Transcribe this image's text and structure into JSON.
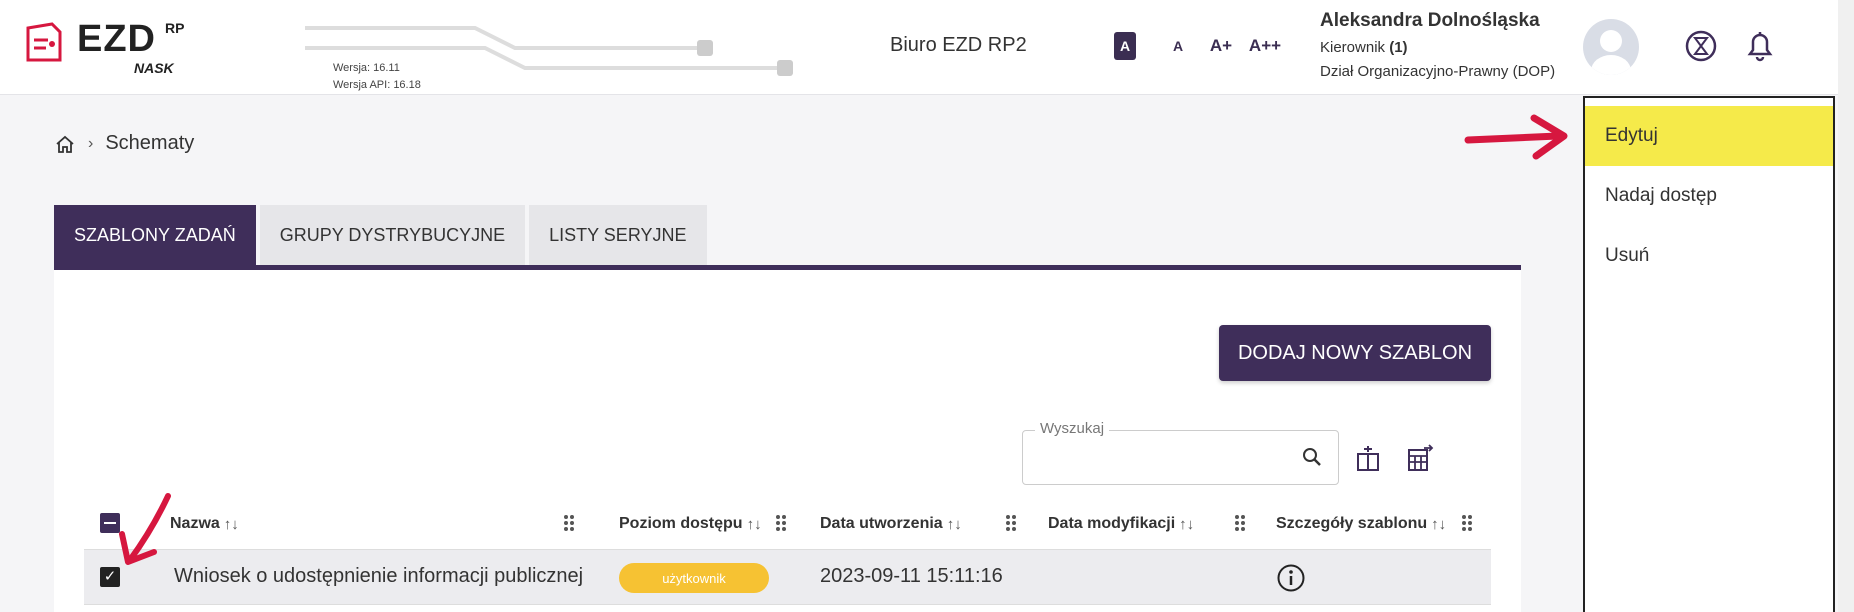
{
  "header": {
    "logo_text": "EZD",
    "logo_superscript": "RP",
    "logo_sub": "NASK",
    "version": "Wersja: 16.11",
    "version_api": "Wersja API: 16.18",
    "office": "Biuro EZD RP2",
    "font_sizes": [
      "A",
      "A",
      "A+",
      "A++"
    ],
    "user_name": "Aleksandra Dolnośląska",
    "user_role": "Kierownik",
    "user_role_count": "(1)",
    "user_department": "Dział Organizacyjno-Prawny (DOP)"
  },
  "breadcrumb": {
    "current": "Schematy"
  },
  "tabs": [
    {
      "label": "SZABLONY ZADAŃ",
      "active": true
    },
    {
      "label": "GRUPY DYSTRYBUCYJNE",
      "active": false
    },
    {
      "label": "LISTY SERYJNE",
      "active": false
    }
  ],
  "actions": {
    "add_label": "DODAJ NOWY SZABLON",
    "search_label": "Wyszukaj",
    "search_value": ""
  },
  "table": {
    "columns": [
      "Nazwa",
      "Poziom dostępu",
      "Data utworzenia",
      "Data modyfikacji",
      "Szczegóły szablonu"
    ],
    "rows": [
      {
        "name": "Wniosek o udostępnienie informacji publicznej",
        "access": "użytkownik",
        "created": "2023-09-11 15:11:16",
        "modified": "",
        "checked": true
      }
    ]
  },
  "context_menu": {
    "items": [
      "Edytuj",
      "Nadaj dostęp",
      "Usuń"
    ],
    "highlighted": "Edytuj"
  },
  "colors": {
    "primary": "#3f2e5a",
    "highlight": "#f5ea4a",
    "badge": "#f6c233",
    "annotation_arrow": "#d6173f"
  },
  "icons": [
    "home-icon",
    "search-icon",
    "column-settings-icon",
    "export-icon",
    "info-icon",
    "hourglass-icon",
    "bell-icon",
    "user-avatar"
  ]
}
